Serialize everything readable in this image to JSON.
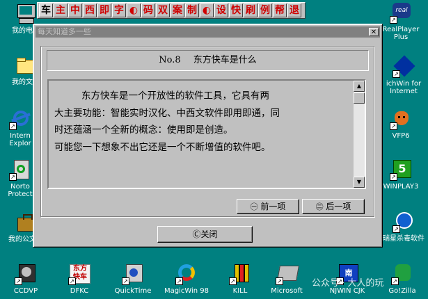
{
  "toolbar": {
    "buttons": [
      "车",
      "主",
      "中",
      "西",
      "即",
      "字",
      "◐",
      "码",
      "双",
      "案",
      "制",
      "◐",
      "设",
      "快",
      "刷",
      "例",
      "帮",
      "退"
    ]
  },
  "desktop": {
    "left_icons": [
      {
        "label": "我的电脑",
        "icon": "computer-icon"
      },
      {
        "label": "我的文档",
        "icon": "folder-icon"
      },
      {
        "label": "Internet Explorer",
        "line1": "Intern",
        "line2": "Explor",
        "icon": "ie-icon"
      },
      {
        "label": "Norton Protect",
        "line1": "Norto",
        "line2": "Protect",
        "icon": "recycle-icon"
      },
      {
        "label": "我的公文包",
        "icon": "briefcase-icon"
      }
    ],
    "right_icons": [
      {
        "label": "RealPlayer Plus",
        "line1": "RealPlayer",
        "line2": "Plus",
        "icon": "realplayer-icon"
      },
      {
        "label": "ichWin for Internet",
        "line1": "ichWin for",
        "line2": "Internet",
        "icon": "richwin-icon"
      },
      {
        "label": "VFP6",
        "icon": "fox-icon"
      },
      {
        "label": "WINPLAY3",
        "icon": "winplay-icon"
      },
      {
        "label": "瑞星杀毒软件",
        "icon": "rising-icon"
      }
    ],
    "bottom_icons": [
      {
        "label": "CCDVP",
        "icon": "ccdvp-icon"
      },
      {
        "label": "DFKC",
        "icon": "dfkc-icon"
      },
      {
        "label": "QuickTime",
        "icon": "quicktime-icon"
      },
      {
        "label": "MagicWin 98",
        "icon": "magicwin-icon"
      },
      {
        "label": "KILL",
        "icon": "kill-icon"
      },
      {
        "label": "Microsoft",
        "icon": "microsoft-icon"
      },
      {
        "label": "NJWIN CJK",
        "icon": "njwin-icon"
      },
      {
        "label": "Go!Zilla",
        "icon": "gozilla-icon"
      }
    ],
    "watermark": "公众号 · 大人的玩"
  },
  "dialog": {
    "title": "每天知道多一些",
    "close": "✕",
    "heading_num": "No.8",
    "heading_text": "东方快车是什么",
    "body": [
      "东方快车是一个开放性的软件工具，它具有两",
      "大主要功能：智能实时汉化、中西文软件即用即通，同",
      "时还蕴涵一个全新的概念：使用即是创造。",
      "可能您一下想象不出它还是一个不断增值的软件吧。"
    ],
    "prev_label": "前一项",
    "prev_key": "㊀",
    "next_label": "后一项",
    "next_key": "㊁",
    "close_label": "Ⓒ关闭"
  }
}
